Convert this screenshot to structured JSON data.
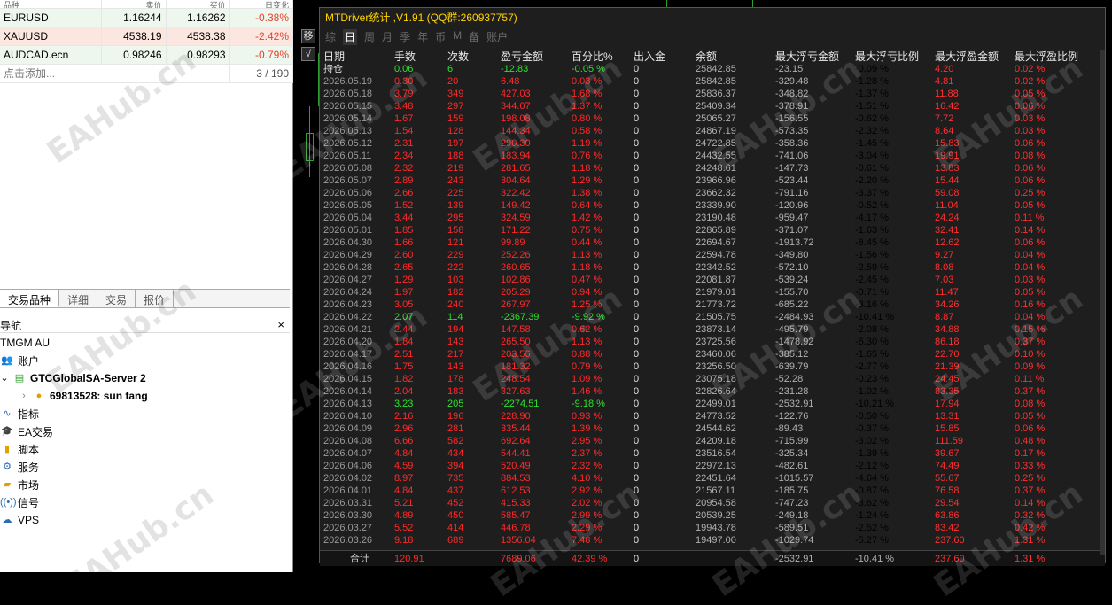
{
  "market_watch": {
    "header": [
      "品种",
      "卖价",
      "买价",
      "日变化"
    ],
    "rows": [
      {
        "symbol": "EURUSD",
        "bid": "1.16244",
        "ask": "1.16262",
        "change": "-0.38%"
      },
      {
        "symbol": "XAUUSD",
        "bid": "4538.19",
        "ask": "4538.38",
        "change": "-2.42%"
      },
      {
        "symbol": "AUDCAD.ecn",
        "bid": "0.98246",
        "ask": "0.98293",
        "change": "-0.79%"
      }
    ],
    "add_label": "点击添加...",
    "count": "3 / 190",
    "tabs": [
      "交易品种",
      "详细",
      "交易",
      "报价"
    ]
  },
  "navigator": {
    "title": "导航",
    "close": "×",
    "broker": "TMGM AU",
    "accounts_label": "账户",
    "server": "GTCGlobalSA-Server 2",
    "account": "69813528: sun fang",
    "items": [
      "指标",
      "EA交易",
      "脚本",
      "服务",
      "市场",
      "信号",
      "VPS"
    ]
  },
  "stats": {
    "title": "MTDriver统计 ,V1.91 (QQ群:260937757)",
    "side_buttons": [
      "移",
      "√"
    ],
    "toolbar": [
      "综",
      "日",
      "周",
      "月",
      "季",
      "年",
      "币",
      "M",
      "备",
      "账户"
    ],
    "active_toolbar": "日",
    "columns": [
      "日期",
      "手数",
      "次数",
      "盈亏金额",
      "百分比%",
      "出入金",
      "余额",
      "最大浮亏金额",
      "最大浮亏比例",
      "最大浮盈金额",
      "最大浮盈比例"
    ],
    "rows": [
      [
        "持仓",
        "0.06",
        "6",
        "-12.83",
        "-0.05 %",
        "0",
        "25842.85",
        "-23.15",
        "-0.09 %",
        "4.20",
        "0.02 %"
      ],
      [
        "2026.05.19",
        "0.30",
        "20",
        "6.48",
        "0.03 %",
        "0",
        "25842.85",
        "-329.48",
        "-1.28 %",
        "4.81",
        "0.02 %"
      ],
      [
        "2026.05.18",
        "3.79",
        "349",
        "427.03",
        "1.68 %",
        "0",
        "25836.37",
        "-348.82",
        "-1.37 %",
        "11.88",
        "0.05 %"
      ],
      [
        "2026.05.15",
        "3.48",
        "297",
        "344.07",
        "1.37 %",
        "0",
        "25409.34",
        "-378.91",
        "-1.51 %",
        "16.42",
        "0.06 %"
      ],
      [
        "2026.05.14",
        "1.67",
        "159",
        "198.08",
        "0.80 %",
        "0",
        "25065.27",
        "-156.55",
        "-0.62 %",
        "7.72",
        "0.03 %"
      ],
      [
        "2026.05.13",
        "1.54",
        "128",
        "144.34",
        "0.58 %",
        "0",
        "24867.19",
        "-573.35",
        "-2.32 %",
        "8.64",
        "0.03 %"
      ],
      [
        "2026.05.12",
        "2.31",
        "197",
        "290.30",
        "1.19 %",
        "0",
        "24722.85",
        "-358.36",
        "-1.45 %",
        "15.83",
        "0.06 %"
      ],
      [
        "2026.05.11",
        "2.34",
        "188",
        "183.94",
        "0.76 %",
        "0",
        "24432.55",
        "-741.06",
        "-3.04 %",
        "19.91",
        "0.08 %"
      ],
      [
        "2026.05.08",
        "2.32",
        "219",
        "281.65",
        "1.18 %",
        "0",
        "24248.61",
        "-147.73",
        "-0.61 %",
        "13.83",
        "0.06 %"
      ],
      [
        "2026.05.07",
        "2.89",
        "243",
        "304.64",
        "1.29 %",
        "0",
        "23966.96",
        "-523.44",
        "-2.20 %",
        "15.44",
        "0.06 %"
      ],
      [
        "2026.05.06",
        "2.66",
        "225",
        "322.42",
        "1.38 %",
        "0",
        "23662.32",
        "-791.16",
        "-3.37 %",
        "59.08",
        "0.25 %"
      ],
      [
        "2026.05.05",
        "1.52",
        "139",
        "149.42",
        "0.64 %",
        "0",
        "23339.90",
        "-120.96",
        "-0.52 %",
        "11.04",
        "0.05 %"
      ],
      [
        "2026.05.04",
        "3.44",
        "295",
        "324.59",
        "1.42 %",
        "0",
        "23190.48",
        "-959.47",
        "-4.17 %",
        "24.24",
        "0.11 %"
      ],
      [
        "2026.05.01",
        "1.85",
        "158",
        "171.22",
        "0.75 %",
        "0",
        "22865.89",
        "-371.07",
        "-1.63 %",
        "32.41",
        "0.14 %"
      ],
      [
        "2026.04.30",
        "1.66",
        "121",
        "99.89",
        "0.44 %",
        "0",
        "22694.67",
        "-1913.72",
        "-8.45 %",
        "12.62",
        "0.06 %"
      ],
      [
        "2026.04.29",
        "2.60",
        "229",
        "252.26",
        "1.13 %",
        "0",
        "22594.78",
        "-349.80",
        "-1.56 %",
        "9.27",
        "0.04 %"
      ],
      [
        "2026.04.28",
        "2.65",
        "222",
        "260.65",
        "1.18 %",
        "0",
        "22342.52",
        "-572.10",
        "-2.59 %",
        "8.08",
        "0.04 %"
      ],
      [
        "2026.04.27",
        "1.29",
        "103",
        "102.86",
        "0.47 %",
        "0",
        "22081.87",
        "-539.24",
        "-2.45 %",
        "7.03",
        "0.03 %"
      ],
      [
        "2026.04.24",
        "1.97",
        "182",
        "205.29",
        "0.94 %",
        "0",
        "21979.01",
        "-155.70",
        "-0.71 %",
        "11.47",
        "0.05 %"
      ],
      [
        "2026.04.23",
        "3.05",
        "240",
        "267.97",
        "1.25 %",
        "0",
        "21773.72",
        "-685.22",
        "-3.16 %",
        "34.26",
        "0.16 %"
      ],
      [
        "2026.04.22",
        "2.07",
        "114",
        "-2367.39",
        "-9.92 %",
        "0",
        "21505.75",
        "-2484.93",
        "-10.41 %",
        "8.87",
        "0.04 %"
      ],
      [
        "2026.04.21",
        "2.44",
        "194",
        "147.58",
        "0.62 %",
        "0",
        "23873.14",
        "-495.79",
        "-2.08 %",
        "34.88",
        "0.15 %"
      ],
      [
        "2026.04.20",
        "1.84",
        "143",
        "265.50",
        "1.13 %",
        "0",
        "23725.56",
        "-1478.92",
        "-6.30 %",
        "86.18",
        "0.37 %"
      ],
      [
        "2026.04.17",
        "2.51",
        "217",
        "203.56",
        "0.88 %",
        "0",
        "23460.06",
        "-385.12",
        "-1.65 %",
        "22.70",
        "0.10 %"
      ],
      [
        "2026.04.16",
        "1.75",
        "143",
        "181.32",
        "0.79 %",
        "0",
        "23256.50",
        "-639.79",
        "-2.77 %",
        "21.39",
        "0.09 %"
      ],
      [
        "2026.04.15",
        "1.82",
        "178",
        "248.54",
        "1.09 %",
        "0",
        "23075.18",
        "-52.28",
        "-0.23 %",
        "24.45",
        "0.11 %"
      ],
      [
        "2026.04.14",
        "2.04",
        "183",
        "327.63",
        "1.46 %",
        "0",
        "22826.64",
        "-231.28",
        "-1.02 %",
        "83.35",
        "0.37 %"
      ],
      [
        "2026.04.13",
        "3.23",
        "205",
        "-2274.51",
        "-9.18 %",
        "0",
        "22499.01",
        "-2532.91",
        "-10.21 %",
        "17.94",
        "0.08 %"
      ],
      [
        "2026.04.10",
        "2.16",
        "196",
        "228.90",
        "0.93 %",
        "0",
        "24773.52",
        "-122.76",
        "-0.50 %",
        "13.31",
        "0.05 %"
      ],
      [
        "2026.04.09",
        "2.96",
        "281",
        "335.44",
        "1.39 %",
        "0",
        "24544.62",
        "-89.43",
        "-0.37 %",
        "15.85",
        "0.06 %"
      ],
      [
        "2026.04.08",
        "6.66",
        "582",
        "692.64",
        "2.95 %",
        "0",
        "24209.18",
        "-715.99",
        "-3.02 %",
        "111.59",
        "0.48 %"
      ],
      [
        "2026.04.07",
        "4.84",
        "434",
        "544.41",
        "2.37 %",
        "0",
        "23516.54",
        "-325.34",
        "-1.39 %",
        "39.67",
        "0.17 %"
      ],
      [
        "2026.04.06",
        "4.59",
        "394",
        "520.49",
        "2.32 %",
        "0",
        "22972.13",
        "-482.61",
        "-2.12 %",
        "74.49",
        "0.33 %"
      ],
      [
        "2026.04.02",
        "8.97",
        "735",
        "884.53",
        "4.10 %",
        "0",
        "22451.64",
        "-1015.57",
        "-4.64 %",
        "55.67",
        "0.25 %"
      ],
      [
        "2026.04.01",
        "4.84",
        "437",
        "612.53",
        "2.92 %",
        "0",
        "21567.11",
        "-185.75",
        "-0.87 %",
        "76.58",
        "0.37 %"
      ],
      [
        "2026.03.31",
        "5.21",
        "452",
        "415.33",
        "2.02 %",
        "0",
        "20954.58",
        "-747.23",
        "-3.62 %",
        "29.54",
        "0.14 %"
      ],
      [
        "2026.03.30",
        "4.89",
        "450",
        "585.47",
        "2.99 %",
        "0",
        "20539.25",
        "-249.18",
        "-1.24 %",
        "63.86",
        "0.32 %"
      ],
      [
        "2026.03.27",
        "5.52",
        "414",
        "446.78",
        "2.29 %",
        "0",
        "19943.78",
        "-589.51",
        "-2.52 %",
        "83.42",
        "0.42 %"
      ],
      [
        "2026.03.26",
        "9.18",
        "689",
        "1356.04",
        "7.48 %",
        "0",
        "19497.00",
        "-1029.74",
        "-5.27 %",
        "237.60",
        "1.31 %"
      ]
    ],
    "total": [
      "合计",
      "120.91",
      "",
      "7689.06",
      "42.39 %",
      "0",
      "",
      "-2532.91",
      "-10.41 %",
      "237.60",
      "1.31 %"
    ]
  },
  "watermark": "EAHub.cn"
}
